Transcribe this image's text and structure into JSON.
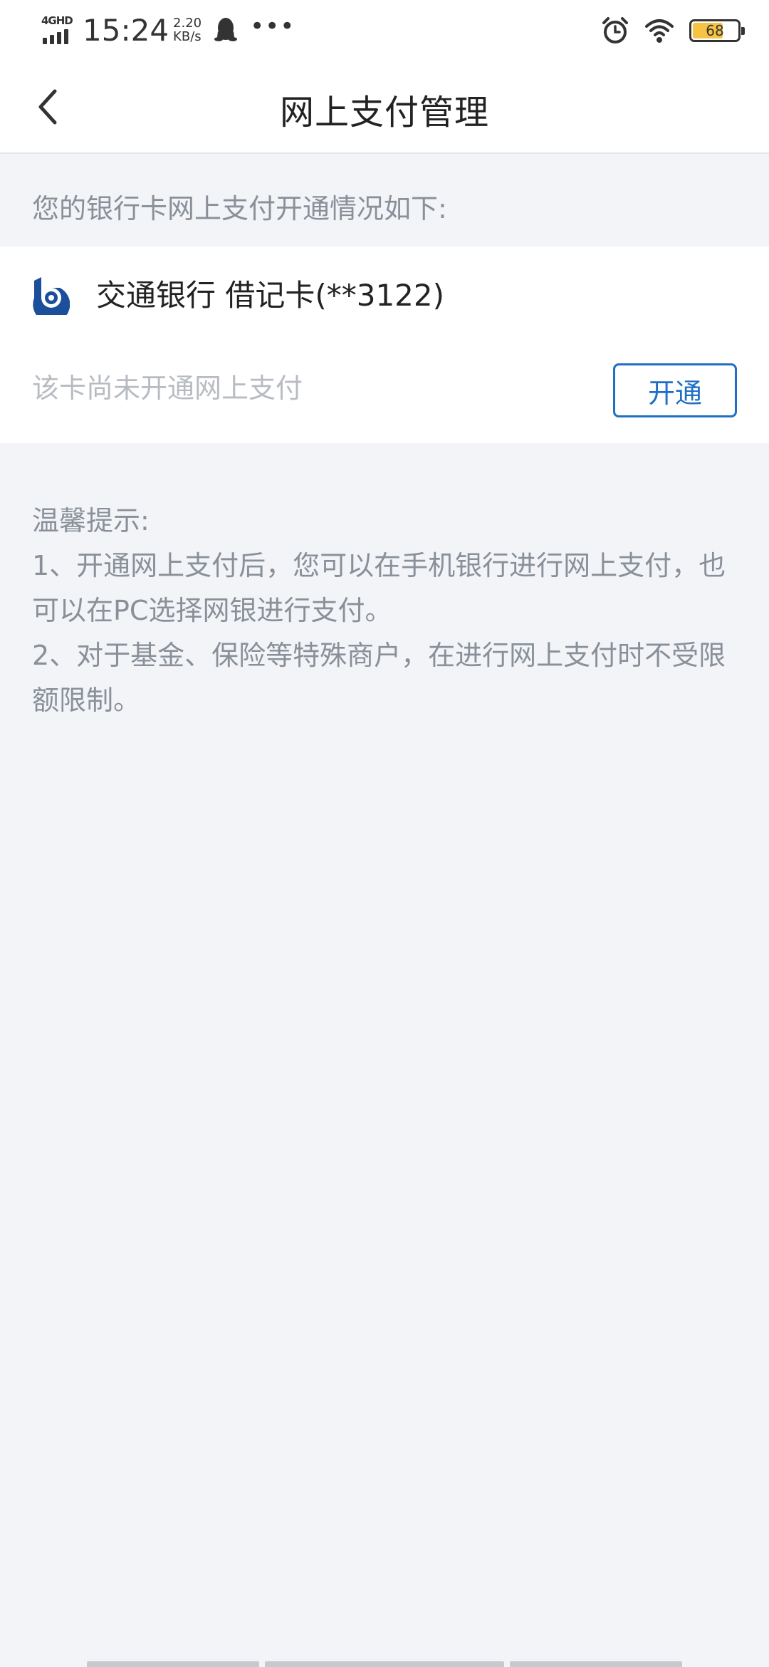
{
  "status_bar": {
    "network": "4GHD",
    "time": "15:24",
    "speed_value": "2.20",
    "speed_unit": "KB/s",
    "more": "•••",
    "battery": "68",
    "battery_level": 0.68,
    "battery_color": "#f6c343",
    "icons": [
      "signal-icon",
      "qq-icon",
      "more-icon",
      "alarm-icon",
      "wifi-icon",
      "battery-icon"
    ]
  },
  "header": {
    "title": "网上支付管理",
    "back_icon": "chevron-left-icon"
  },
  "main": {
    "intro": "您的银行卡网上支付开通情况如下:",
    "card": {
      "bank_logo": "bank-of-communications-logo",
      "name": "交通银行 借记卡(**3122)",
      "status": "该卡尚未开通网上支付",
      "action_label": "开通",
      "accent_color": "#1f6fc5"
    },
    "tips": {
      "title": "温馨提示:",
      "items": [
        "1、开通网上支付后，您可以在手机银行进行网上支付，也可以在PC选择网银进行支付。",
        "2、对于基金、保险等特殊商户，在进行网上支付时不受限额限制。"
      ]
    }
  }
}
